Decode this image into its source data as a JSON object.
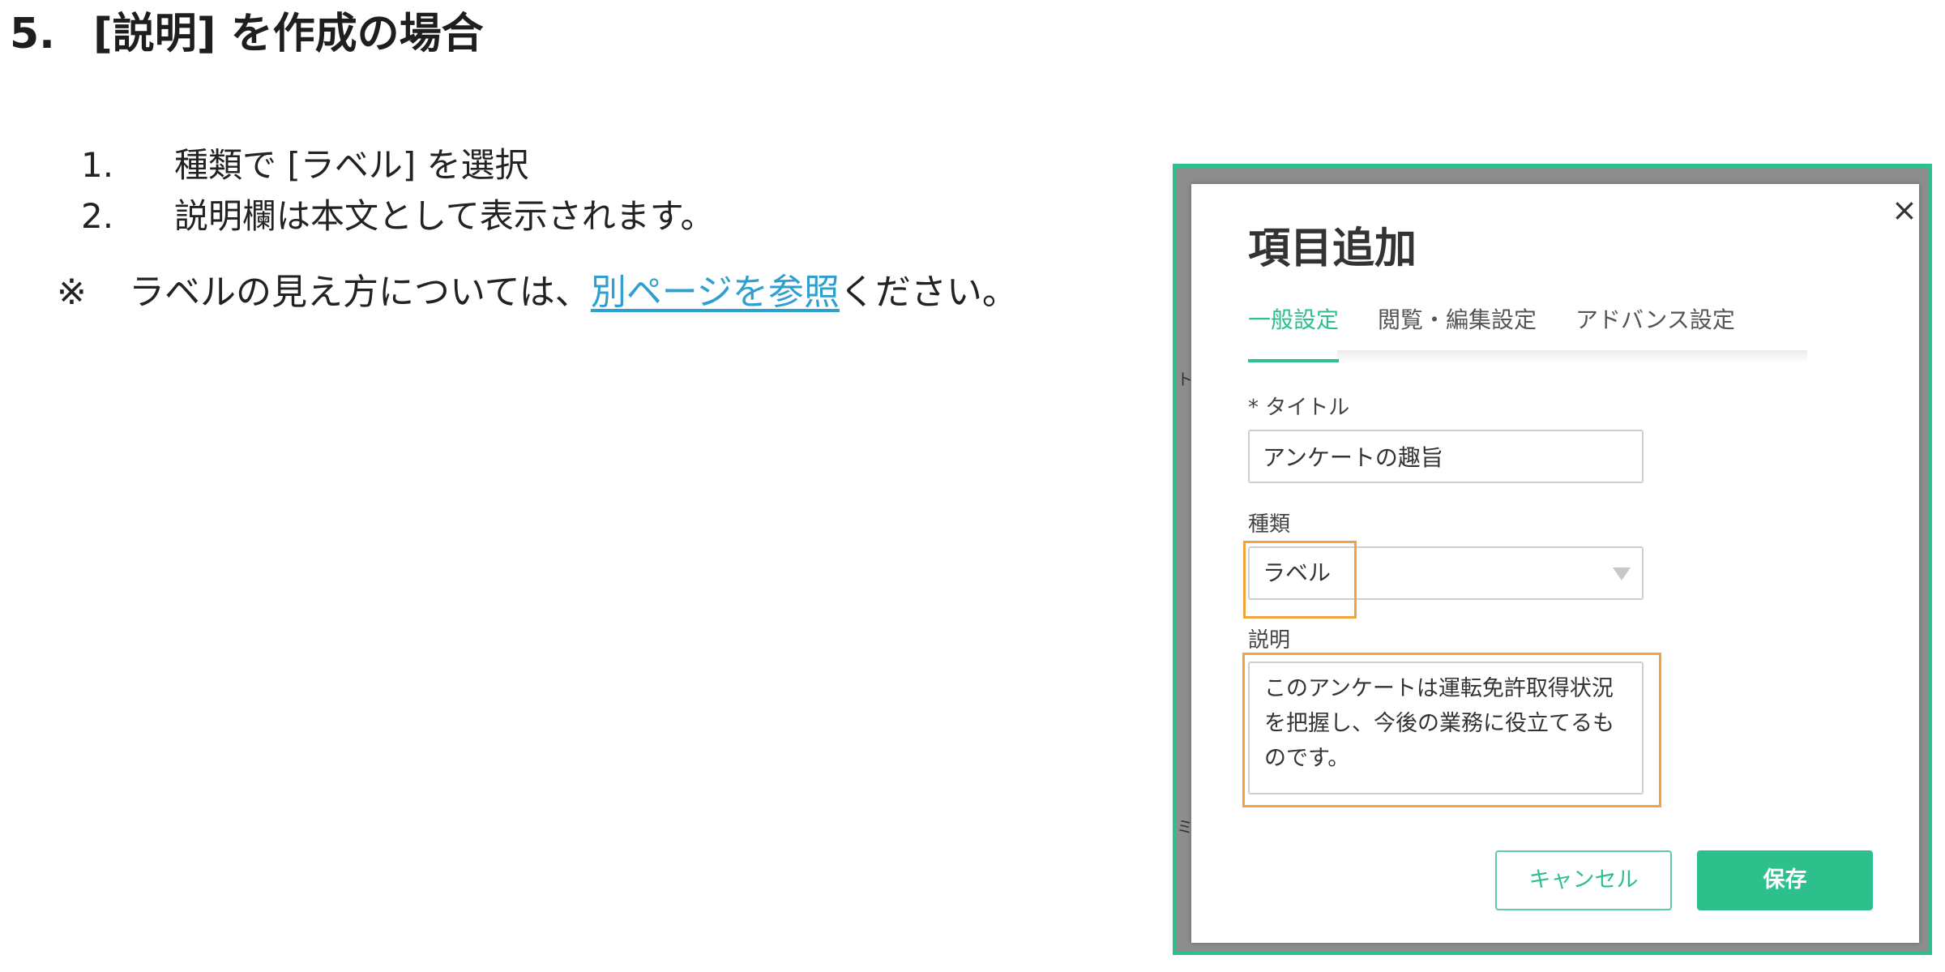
{
  "section": {
    "number": "5.",
    "title": "[説明] を作成の場合"
  },
  "steps": [
    {
      "num": "1.",
      "text": "種類で [ラベル] を選択"
    },
    {
      "num": "2.",
      "text": "説明欄は本文として表示されます。"
    }
  ],
  "note": {
    "mark": "※",
    "before": "ラベルの見え方については、",
    "link": "別ページを参照",
    "after": "ください。"
  },
  "screenshot": {
    "background_fragments": [
      "ト",
      "ミ"
    ],
    "dialog": {
      "close": "×",
      "title": "項目追加",
      "tabs": [
        "一般設定",
        "閲覧・編集設定",
        "アドバンス設定"
      ],
      "active_tab": 0,
      "title_field": {
        "label": "* タイトル",
        "value": "アンケートの趣旨"
      },
      "type_field": {
        "label": "種類",
        "value": "ラベル"
      },
      "description_field": {
        "label": "説明",
        "value": "このアンケートは運転免許取得状況を把握し、今後の業務に役立てるものです。"
      },
      "buttons": {
        "cancel": "キャンセル",
        "save": "保存"
      }
    }
  },
  "colors": {
    "accent": "#2ec08c",
    "highlight": "#f0a340",
    "link": "#2f9fd0"
  }
}
